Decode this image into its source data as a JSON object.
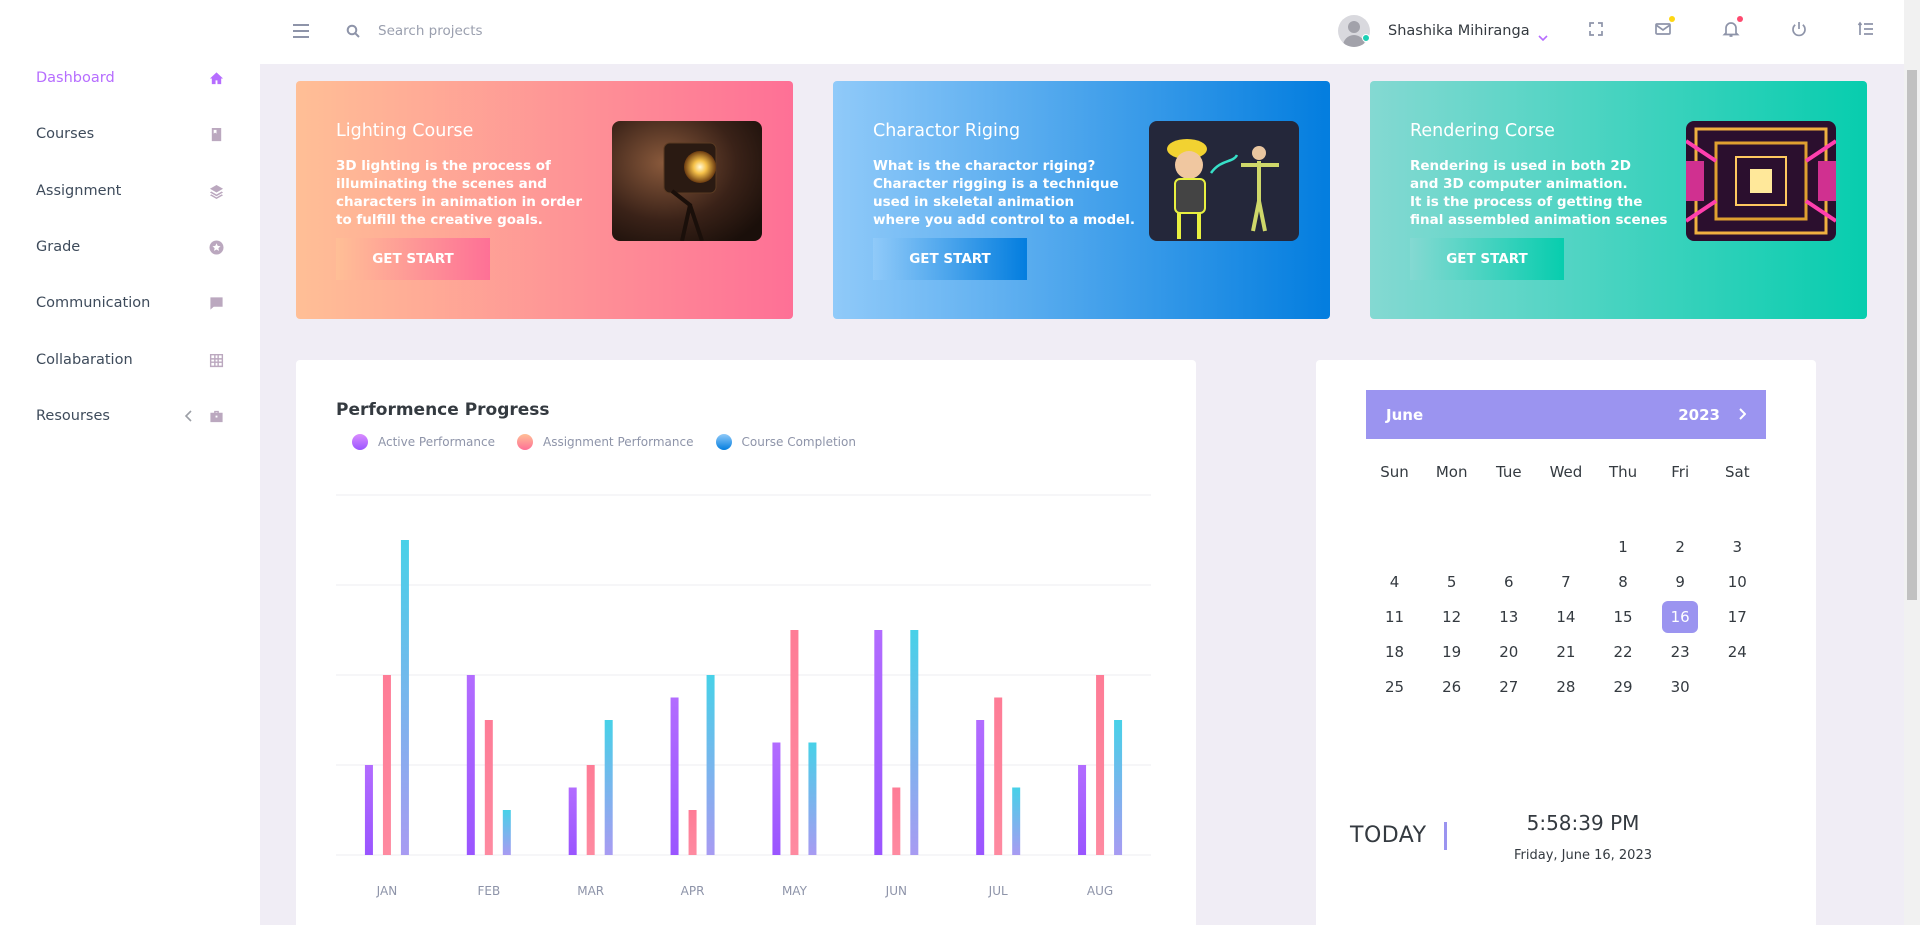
{
  "sidebar": {
    "items": [
      {
        "label": "Dashboard",
        "icon": "home-icon"
      },
      {
        "label": "Courses",
        "icon": "book-icon"
      },
      {
        "label": "Assignment",
        "icon": "layers-icon"
      },
      {
        "label": "Grade",
        "icon": "star-circle-icon"
      },
      {
        "label": "Communication",
        "icon": "chat-icon"
      },
      {
        "label": "Collabaration",
        "icon": "table-icon"
      },
      {
        "label": "Resourses",
        "icon": "briefcase-icon"
      }
    ],
    "active": "Dashboard"
  },
  "topbar": {
    "search_placeholder": "Search projects",
    "user_name": "Shashika Mihiranga",
    "icons": [
      "menu-icon",
      "search-icon",
      "fullscreen-icon",
      "mail-icon",
      "bell-icon",
      "power-icon",
      "list-icon"
    ]
  },
  "cards": [
    {
      "title": "Lighting Course",
      "description": "3D lighting is the process of\nilluminating the scenes and\ncharacters in animation in order\nto fulfill the creative goals.",
      "button": "GET START"
    },
    {
      "title": "Charactor Riging",
      "description": "What is the charactor riging?\nCharacter rigging is a technique\nused in skeletal animation\nwhere you add control to a model.",
      "button": "GET START"
    },
    {
      "title": "Rendering Corse",
      "description": "Rendering is used in both 2D\nand 3D computer animation.\nIt is the process of getting the\nfinal assembled animation scenes",
      "button": "GET START"
    }
  ],
  "chart": {
    "title": "Performence Progress"
  },
  "chart_data": {
    "type": "bar",
    "categories": [
      "JAN",
      "FEB",
      "MAR",
      "APR",
      "MAY",
      "JUN",
      "JUL",
      "AUG"
    ],
    "series": [
      {
        "name": "Active Performance",
        "color": "#9a55ff",
        "values": [
          20,
          40,
          15,
          35,
          25,
          50,
          30,
          20
        ]
      },
      {
        "name": "Assignment Performance",
        "color": "#fe7c96",
        "values": [
          40,
          30,
          20,
          10,
          50,
          15,
          35,
          40
        ]
      },
      {
        "name": "Course Completion",
        "color": "#73b4ea",
        "values": [
          70,
          10,
          30,
          40,
          25,
          50,
          15,
          30
        ]
      }
    ],
    "ylim": [
      0,
      80
    ],
    "grid": true,
    "legend": "top-left"
  },
  "calendar": {
    "month": "June",
    "year": "2023",
    "weekdays": [
      "Sun",
      "Mon",
      "Tue",
      "Wed",
      "Thu",
      "Fri",
      "Sat"
    ],
    "weeks": [
      [
        "",
        "",
        "",
        "",
        "1",
        "2",
        "3"
      ],
      [
        "4",
        "5",
        "6",
        "7",
        "8",
        "9",
        "10"
      ],
      [
        "11",
        "12",
        "13",
        "14",
        "15",
        "16",
        "17"
      ],
      [
        "18",
        "19",
        "20",
        "21",
        "22",
        "23",
        "24"
      ],
      [
        "25",
        "26",
        "27",
        "28",
        "29",
        "30",
        ""
      ]
    ],
    "selected": "16",
    "today_label": "TODAY",
    "time": "5:58:39 PM",
    "date": "Friday, June 16, 2023"
  }
}
